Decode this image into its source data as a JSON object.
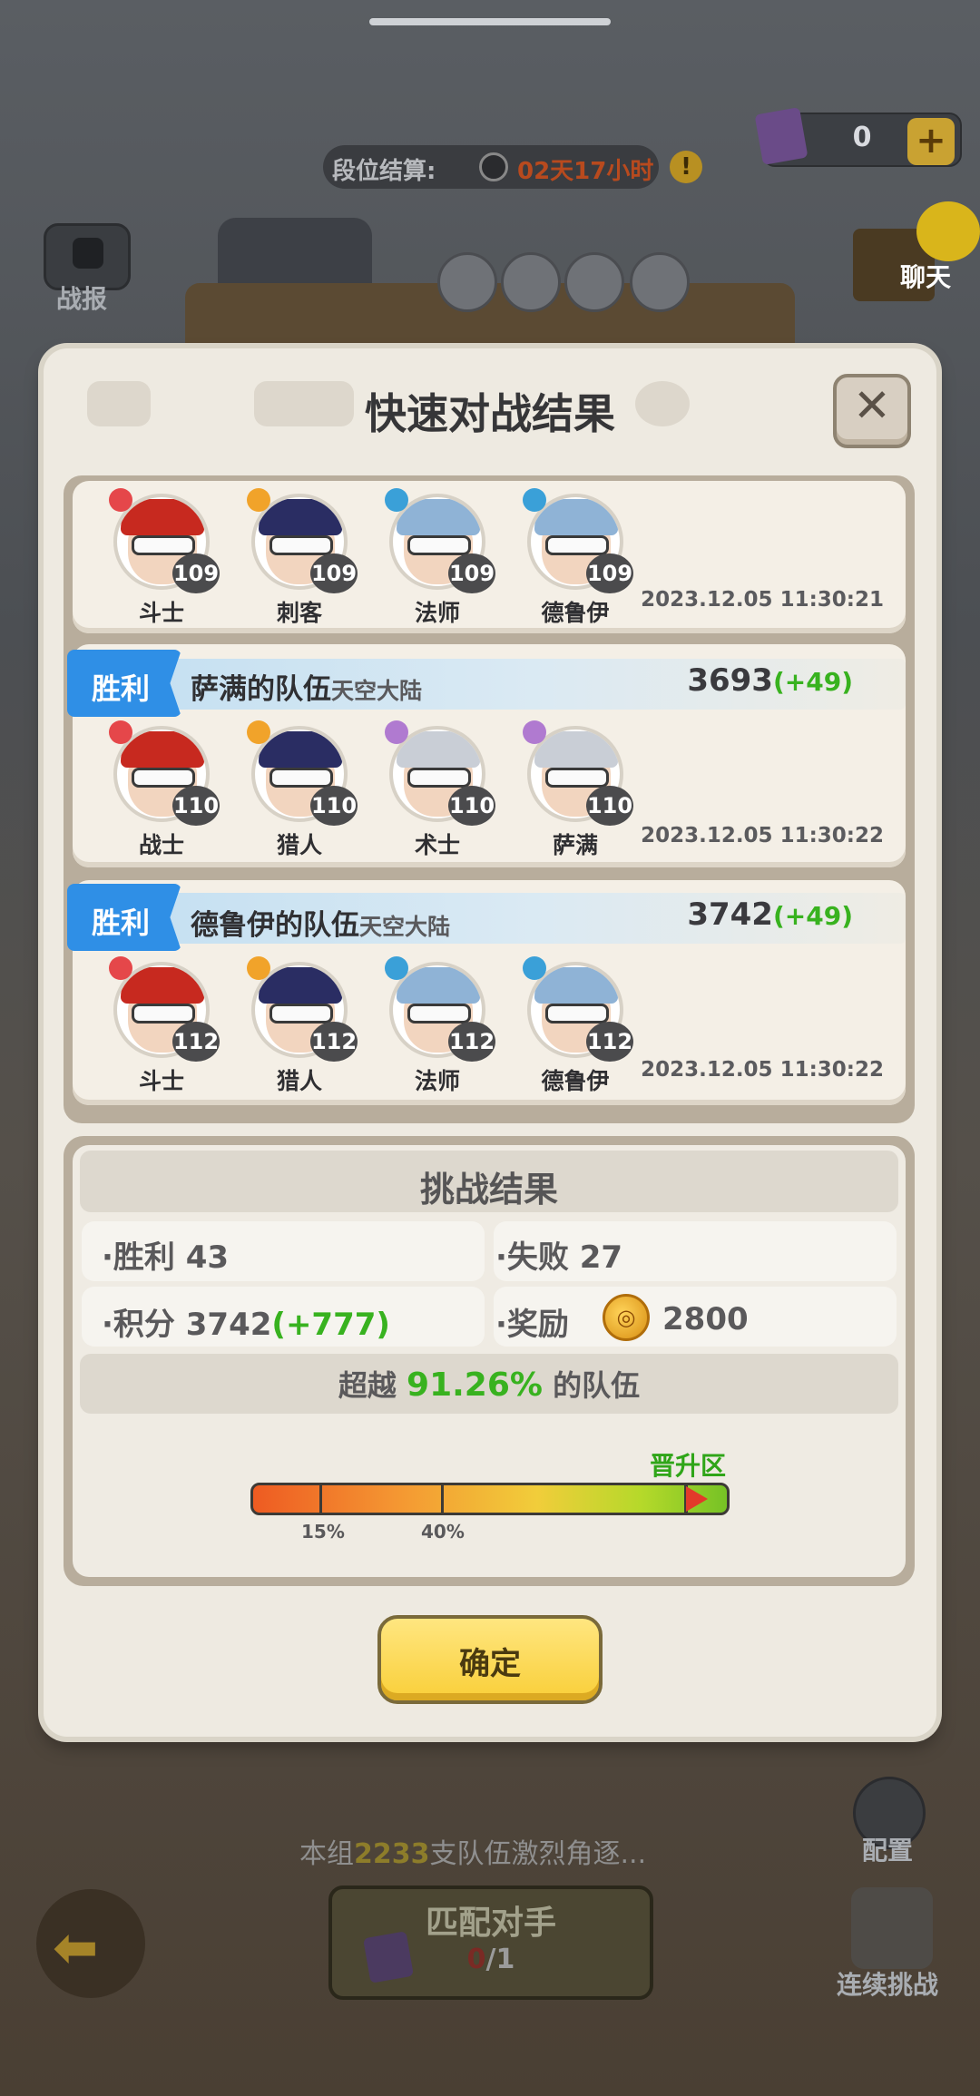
{
  "background": {
    "resource_count": "0",
    "settle_label": "段位结算:",
    "settle_time": "02天17小时",
    "report_label": "战报",
    "chat_label": "聊天",
    "config_label": "配置",
    "group_text_prefix": "本组",
    "group_count": "2233",
    "group_text_suffix": "支队伍激烈角逐...",
    "match_label": "匹配对手",
    "match_used": "0",
    "match_total": "/1",
    "continue_label": "连续挑战"
  },
  "dialog": {
    "title": "快速对战结果",
    "confirm_label": "确定",
    "battles": [
      {
        "result": "",
        "team": "",
        "region": "",
        "score": "",
        "delta": "",
        "time": "2023.12.05 11:30:21",
        "heroes": [
          {
            "name": "斗士",
            "level": "109"
          },
          {
            "name": "刺客",
            "level": "109"
          },
          {
            "name": "法师",
            "level": "109"
          },
          {
            "name": "德鲁伊",
            "level": "109"
          }
        ]
      },
      {
        "result": "胜利",
        "team": "萨满的队伍",
        "region": "天空大陆",
        "score": "3693",
        "delta": "(+49)",
        "time": "2023.12.05 11:30:22",
        "heroes": [
          {
            "name": "战士",
            "level": "110"
          },
          {
            "name": "猎人",
            "level": "110"
          },
          {
            "name": "术士",
            "level": "110"
          },
          {
            "name": "萨满",
            "level": "110"
          }
        ]
      },
      {
        "result": "胜利",
        "team": "德鲁伊的队伍",
        "region": "天空大陆",
        "score": "3742",
        "delta": "(+49)",
        "time": "2023.12.05 11:30:22",
        "heroes": [
          {
            "name": "斗士",
            "level": "112"
          },
          {
            "name": "猎人",
            "level": "112"
          },
          {
            "name": "法师",
            "level": "112"
          },
          {
            "name": "德鲁伊",
            "level": "112"
          }
        ]
      }
    ],
    "result": {
      "title": "挑战结果",
      "win_label": "·胜利",
      "win_value": "43",
      "lose_label": "·失败",
      "lose_value": "27",
      "points_label": "·积分",
      "points_value": "3742",
      "points_delta": "(+777)",
      "reward_label": "·奖励",
      "reward_value": "2800",
      "exceed_prefix": "超越",
      "exceed_value": "91.26%",
      "exceed_suffix": "的队伍",
      "promo_label": "晋升区",
      "tick1": "15%",
      "tick2": "40%",
      "progress_fraction": 0.9126
    }
  },
  "colors": {
    "win_tag": "#2f8fe6",
    "positive": "#38b21f",
    "confirm": "#f9cf38"
  }
}
